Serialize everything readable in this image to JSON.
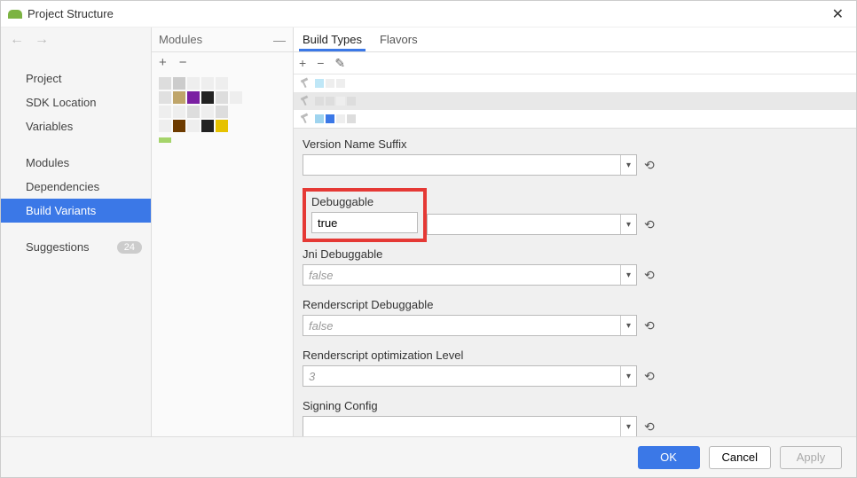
{
  "window": {
    "title": "Project Structure"
  },
  "sidebar": {
    "groups": [
      [
        "Project",
        "SDK Location",
        "Variables"
      ],
      [
        "Modules",
        "Dependencies",
        "Build Variants"
      ],
      [
        "Suggestions"
      ]
    ],
    "selected": "Build Variants",
    "badge": "24"
  },
  "modules": {
    "header": "Modules"
  },
  "tabs": {
    "build_types": "Build Types",
    "flavors": "Flavors",
    "active": "Build Types"
  },
  "form": {
    "fields": [
      {
        "key": "version_name_suffix",
        "label": "Version Name Suffix",
        "value": "",
        "placeholder": ""
      },
      {
        "key": "debuggable",
        "label": "Debuggable",
        "value": "true",
        "highlight": true
      },
      {
        "key": "jni_debuggable",
        "label": "Jni Debuggable",
        "value": "",
        "placeholder": "false"
      },
      {
        "key": "renderscript_debuggable",
        "label": "Renderscript Debuggable",
        "value": "",
        "placeholder": "false"
      },
      {
        "key": "renderscript_optimization_level",
        "label": "Renderscript optimization Level",
        "value": "",
        "placeholder": "3"
      },
      {
        "key": "signing_config",
        "label": "Signing Config",
        "value": "",
        "placeholder": ""
      }
    ]
  },
  "footer": {
    "ok": "OK",
    "cancel": "Cancel",
    "apply": "Apply"
  }
}
